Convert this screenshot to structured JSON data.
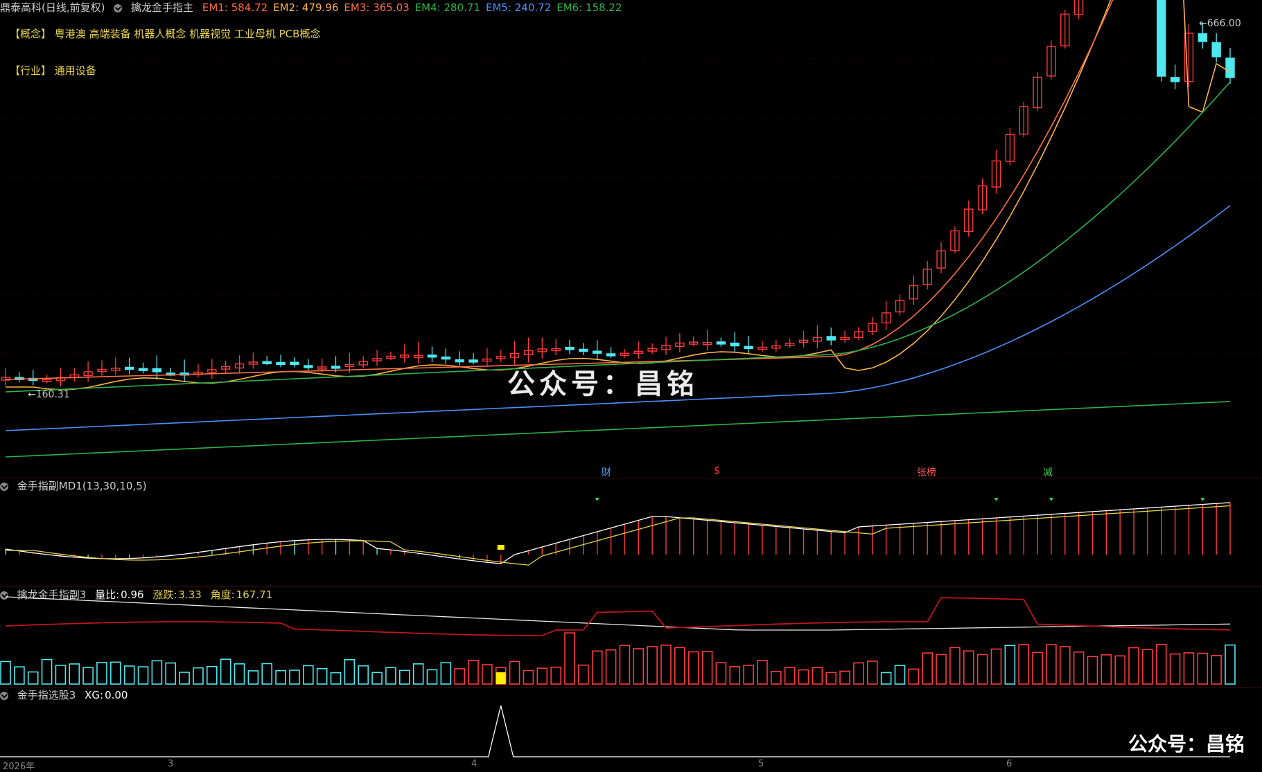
{
  "header": {
    "stock": "鼎泰高科(日线,前复权)",
    "indicator": "擒龙金手指主",
    "em": [
      {
        "label": "EM1:",
        "value": "584.72",
        "color": "#ff6a3d"
      },
      {
        "label": "EM2:",
        "value": "479.96",
        "color": "#ffb347"
      },
      {
        "label": "EM3:",
        "value": "365.03",
        "color": "#ff7043"
      },
      {
        "label": "EM4:",
        "value": "280.71",
        "color": "#2fb34a"
      },
      {
        "label": "EM5:",
        "value": "240.72",
        "color": "#4a90ff"
      },
      {
        "label": "EM6:",
        "value": "158.22",
        "color": "#2fb34a"
      }
    ]
  },
  "tags": {
    "concept_label": "【概念】",
    "concept_items": "粤港澳 高端装备 机器人概念 机器视觉 工业母机 PCB概念",
    "industry_label": "【行业】",
    "industry_items": "通用设备"
  },
  "price": {
    "high_label": "666.00",
    "low_label": "160.31"
  },
  "event_markers": [
    "财",
    "$",
    "张榜",
    "减"
  ],
  "sub1": {
    "title": "金手指副MD1(13,30,10,5)"
  },
  "sub2": {
    "title": "擒龙金手指副3",
    "vol_ratio_label": "量比:",
    "vol_ratio": "0.96",
    "change_label": "涨跌:",
    "change": "3.33",
    "angle_label": "角度:",
    "angle": "167.71"
  },
  "sub3": {
    "title": "金手指选股3",
    "xg_label": "XG:",
    "xg": "0.00"
  },
  "xaxis": {
    "labels": [
      "2026年",
      "3",
      "4",
      "5",
      "6"
    ]
  },
  "watermarks": {
    "center": "公众号：昌铭",
    "corner": "公众号：昌铭"
  },
  "colors": {
    "up": "#ff3b3b",
    "down": "#4de8f0",
    "bg": "#000000"
  }
}
